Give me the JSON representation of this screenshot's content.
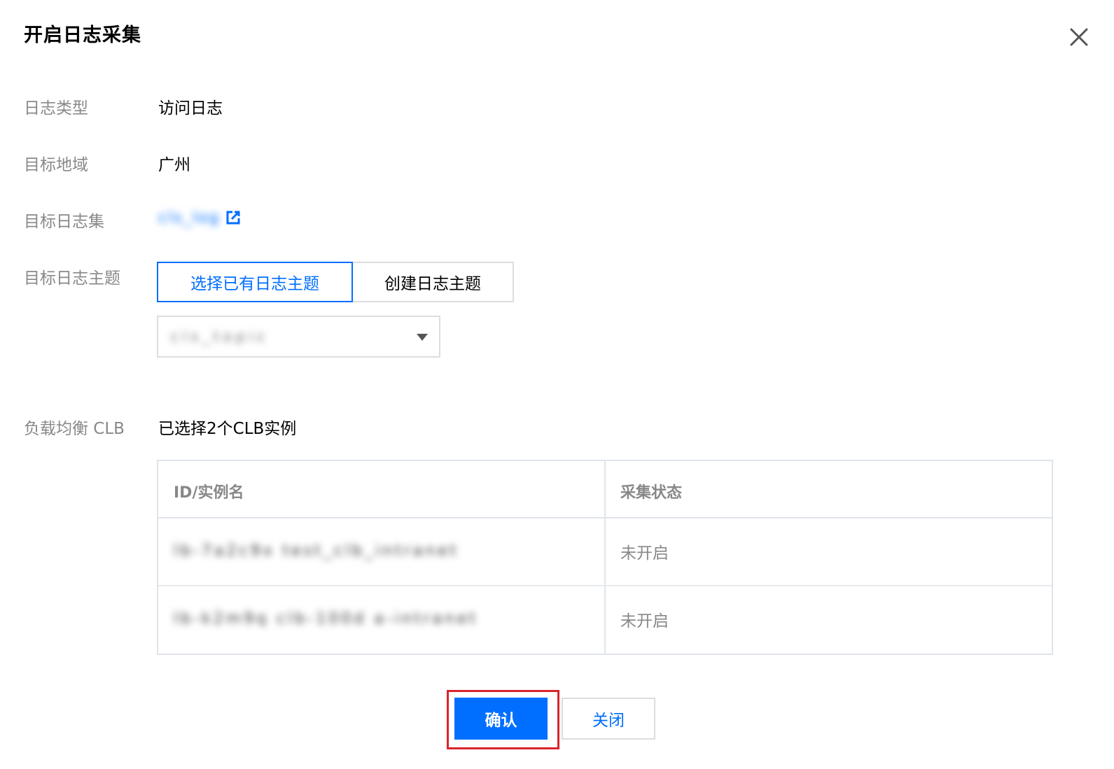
{
  "dialog": {
    "title": "开启日志采集",
    "close_icon": "close-icon"
  },
  "form": {
    "log_type": {
      "label": "日志类型",
      "value": "访问日志"
    },
    "region": {
      "label": "目标地域",
      "value": "广州"
    },
    "logset": {
      "label": "目标日志集",
      "value": "cls_log",
      "link_icon": "external-link-icon"
    },
    "topic": {
      "label": "目标日志主题",
      "tabs": [
        {
          "label": "选择已有日志主题",
          "active": true
        },
        {
          "label": "创建日志主题",
          "active": false
        }
      ],
      "select_value": "cls_topic",
      "select_icon": "caret-down-icon"
    },
    "clb": {
      "label": "负载均衡 CLB",
      "value": "已选择2个CLB实例"
    }
  },
  "table": {
    "headers": [
      "ID/实例名",
      "采集状态"
    ],
    "rows": [
      {
        "id_name": "lb-7a2c9x  test_clb_intranet",
        "status": "未开启"
      },
      {
        "id_name": "lb-k2m9q  clb-100d  a-intranet",
        "status": "未开启"
      }
    ]
  },
  "footer": {
    "confirm_label": "确认",
    "close_label": "关闭"
  },
  "colors": {
    "primary": "#006eff",
    "highlight": "#d9252c",
    "label": "#888888"
  }
}
